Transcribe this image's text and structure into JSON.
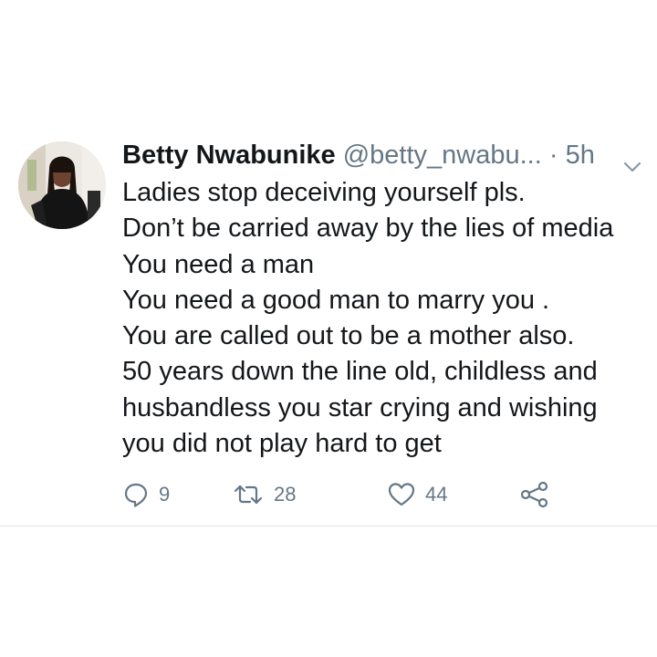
{
  "tweet": {
    "author_name": "Betty Nwabunike",
    "handle": "@betty_nwabu...",
    "separator": "·",
    "time": "5h",
    "lines": [
      "Ladies stop deceiving yourself pls.",
      "Don’t be carried away by the lies of media",
      "You need a man",
      "You need a good man to marry you .",
      "You are called out to be a mother also.",
      "50 years down the line old, childless and",
      "husbandless you star crying and wishing",
      "you did not play hard to get"
    ],
    "actions": {
      "reply_icon": "reply-bubble-icon",
      "replies": "9",
      "retweet_icon": "retweet-icon",
      "retweets": "28",
      "like_icon": "heart-icon",
      "likes": "44",
      "share_icon": "share-icon"
    }
  },
  "colors": {
    "text": "#14171a",
    "secondary": "#657786",
    "divider": "#dfe3e6",
    "background": "#ffffff"
  }
}
